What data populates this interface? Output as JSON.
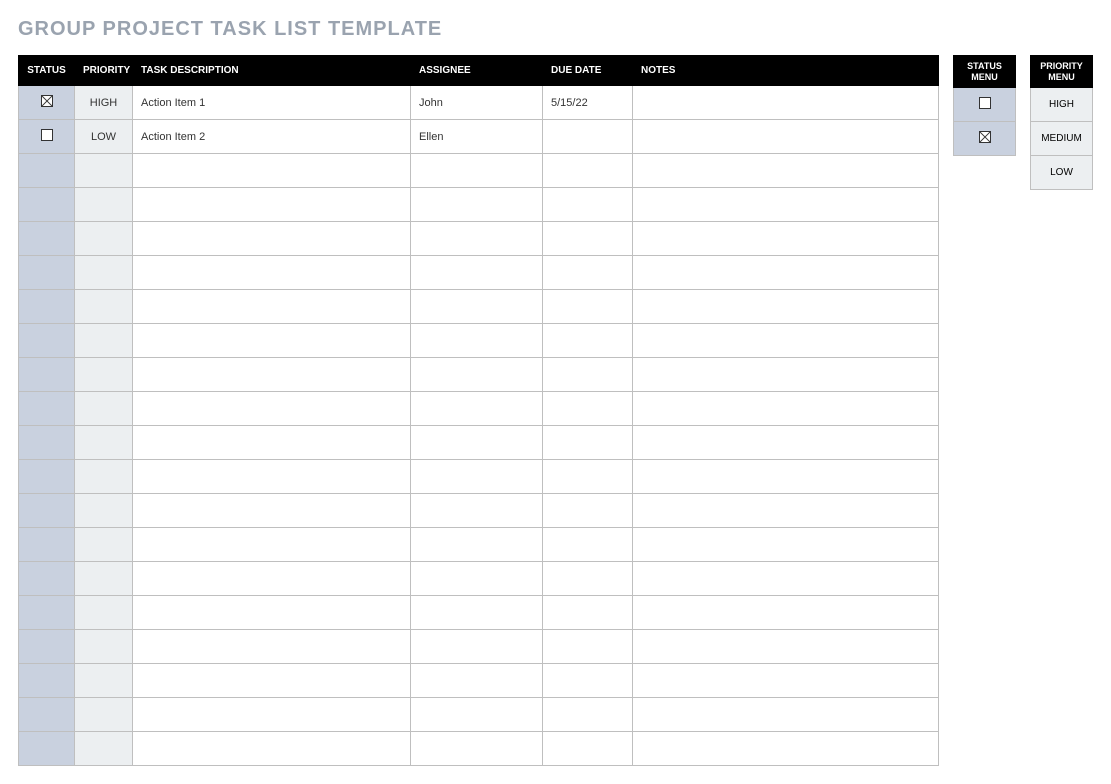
{
  "title": "GROUP PROJECT TASK LIST TEMPLATE",
  "headers": {
    "status": "STATUS",
    "priority": "PRIORITY",
    "task": "TASK DESCRIPTION",
    "assignee": "ASSIGNEE",
    "duedate": "DUE DATE",
    "notes": "NOTES"
  },
  "rows": [
    {
      "status_checked": true,
      "priority": "HIGH",
      "task": "Action Item 1",
      "assignee": "John",
      "duedate": "5/15/22",
      "notes": ""
    },
    {
      "status_checked": false,
      "priority": "LOW",
      "task": "Action Item 2",
      "assignee": "Ellen",
      "duedate": "",
      "notes": ""
    },
    {
      "status_checked": null,
      "priority": "",
      "task": "",
      "assignee": "",
      "duedate": "",
      "notes": ""
    },
    {
      "status_checked": null,
      "priority": "",
      "task": "",
      "assignee": "",
      "duedate": "",
      "notes": ""
    },
    {
      "status_checked": null,
      "priority": "",
      "task": "",
      "assignee": "",
      "duedate": "",
      "notes": ""
    },
    {
      "status_checked": null,
      "priority": "",
      "task": "",
      "assignee": "",
      "duedate": "",
      "notes": ""
    },
    {
      "status_checked": null,
      "priority": "",
      "task": "",
      "assignee": "",
      "duedate": "",
      "notes": ""
    },
    {
      "status_checked": null,
      "priority": "",
      "task": "",
      "assignee": "",
      "duedate": "",
      "notes": ""
    },
    {
      "status_checked": null,
      "priority": "",
      "task": "",
      "assignee": "",
      "duedate": "",
      "notes": ""
    },
    {
      "status_checked": null,
      "priority": "",
      "task": "",
      "assignee": "",
      "duedate": "",
      "notes": ""
    },
    {
      "status_checked": null,
      "priority": "",
      "task": "",
      "assignee": "",
      "duedate": "",
      "notes": ""
    },
    {
      "status_checked": null,
      "priority": "",
      "task": "",
      "assignee": "",
      "duedate": "",
      "notes": ""
    },
    {
      "status_checked": null,
      "priority": "",
      "task": "",
      "assignee": "",
      "duedate": "",
      "notes": ""
    },
    {
      "status_checked": null,
      "priority": "",
      "task": "",
      "assignee": "",
      "duedate": "",
      "notes": ""
    },
    {
      "status_checked": null,
      "priority": "",
      "task": "",
      "assignee": "",
      "duedate": "",
      "notes": ""
    },
    {
      "status_checked": null,
      "priority": "",
      "task": "",
      "assignee": "",
      "duedate": "",
      "notes": ""
    },
    {
      "status_checked": null,
      "priority": "",
      "task": "",
      "assignee": "",
      "duedate": "",
      "notes": ""
    },
    {
      "status_checked": null,
      "priority": "",
      "task": "",
      "assignee": "",
      "duedate": "",
      "notes": ""
    },
    {
      "status_checked": null,
      "priority": "",
      "task": "",
      "assignee": "",
      "duedate": "",
      "notes": ""
    },
    {
      "status_checked": null,
      "priority": "",
      "task": "",
      "assignee": "",
      "duedate": "",
      "notes": ""
    }
  ],
  "status_menu": {
    "header": "STATUS MENU",
    "options": [
      {
        "checked": false
      },
      {
        "checked": true
      }
    ]
  },
  "priority_menu": {
    "header": "PRIORITY MENU",
    "options": [
      "HIGH",
      "MEDIUM",
      "LOW"
    ]
  }
}
